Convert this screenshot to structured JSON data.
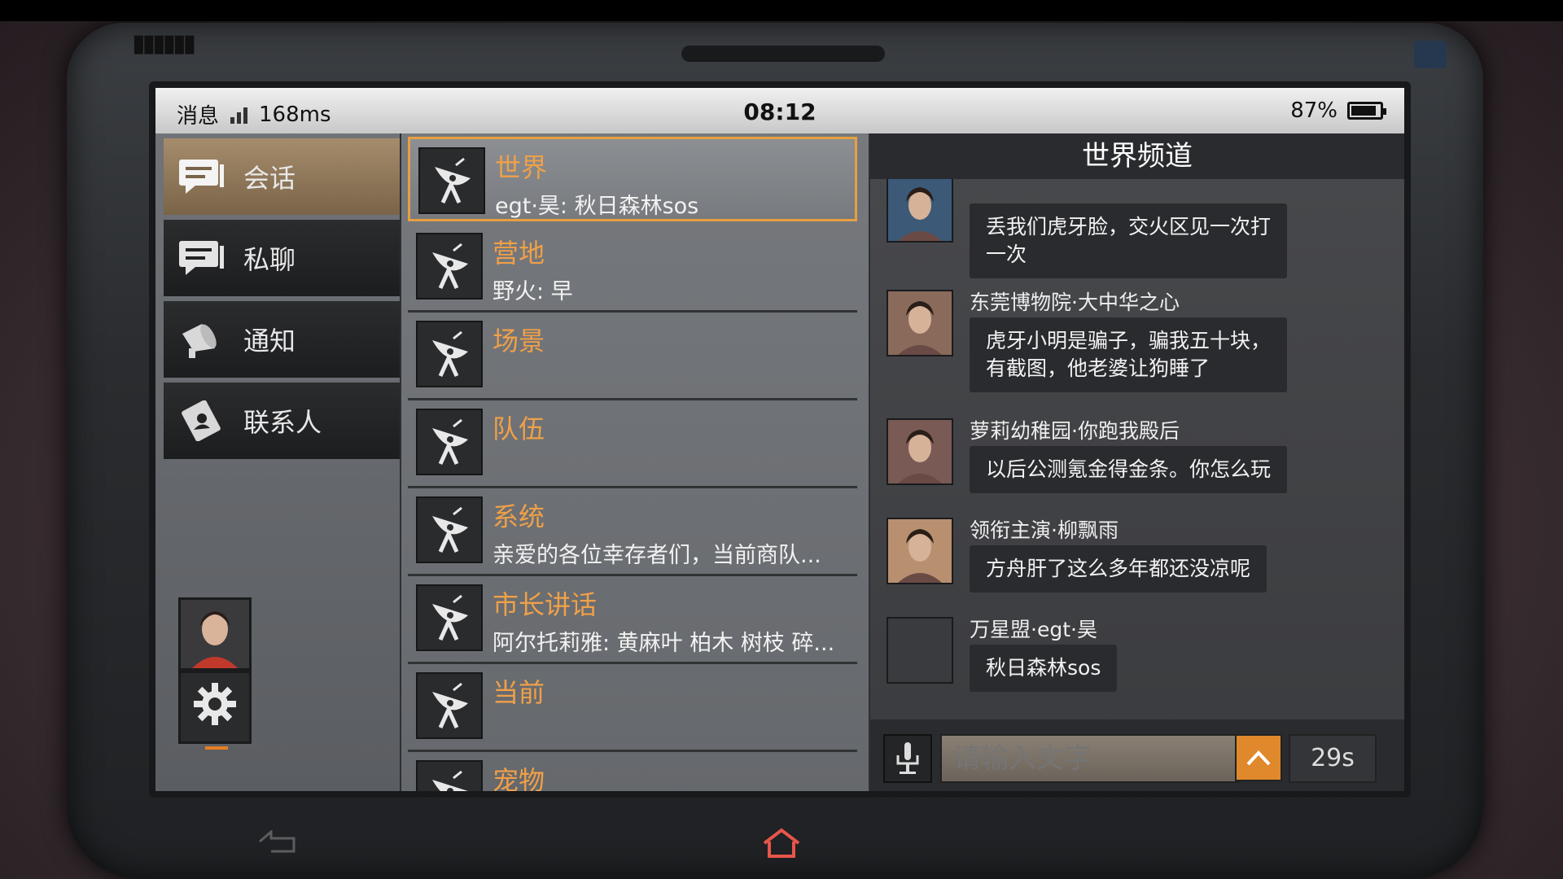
{
  "status": {
    "label": "消息",
    "ping": "168ms",
    "time": "08:12",
    "battery": "87%",
    "battery_level": 0.87
  },
  "sidebar": {
    "items": [
      {
        "label": "会话",
        "icon": "chat-icon",
        "active": true
      },
      {
        "label": "私聊",
        "icon": "private-chat-icon",
        "active": false
      },
      {
        "label": "通知",
        "icon": "megaphone-icon",
        "active": false
      },
      {
        "label": "联系人",
        "icon": "contacts-icon",
        "active": false
      }
    ]
  },
  "channels": [
    {
      "name": "世界",
      "last": "egt·昊: 秋日森林sos",
      "selected": true
    },
    {
      "name": "营地",
      "last": "野火: 早"
    },
    {
      "name": "场景",
      "last": ""
    },
    {
      "name": "队伍",
      "last": ""
    },
    {
      "name": "系统",
      "last": "亲爱的各位幸存者们，当前商队..."
    },
    {
      "name": "市长讲话",
      "last": "阿尔托莉雅: 黄麻叶 柏木 树枝 碎..."
    },
    {
      "name": "当前",
      "last": ""
    },
    {
      "name": "宠物",
      "last": ""
    }
  ],
  "chat": {
    "title": "世界频道",
    "messages": [
      {
        "sender": "",
        "text": "丢我们虎牙脸，交火区见一次打\n一次",
        "face": "#3c5a78"
      },
      {
        "sender": "东莞博物院·大中华之心",
        "text": "虎牙小明是骗子，骗我五十块，\n有截图，他老婆让狗睡了",
        "face": "#8a6a5a"
      },
      {
        "sender": "萝莉幼稚园·你跑我殿后",
        "text": "以后公测氪金得金条。你怎么玩",
        "face": "#7a5a55"
      },
      {
        "sender": "领衔主演·柳飘雨",
        "text": "方舟肝了这么多年都还没凉呢",
        "face": "#b89070"
      },
      {
        "sender": "万星盟·egt·昊",
        "text": "秋日森林sos",
        "face": "#3a3b3e"
      }
    ],
    "input_placeholder": "请输入文字",
    "cooldown": "29s"
  },
  "colors": {
    "accent": "#e6a040",
    "send": "#e0882c"
  }
}
